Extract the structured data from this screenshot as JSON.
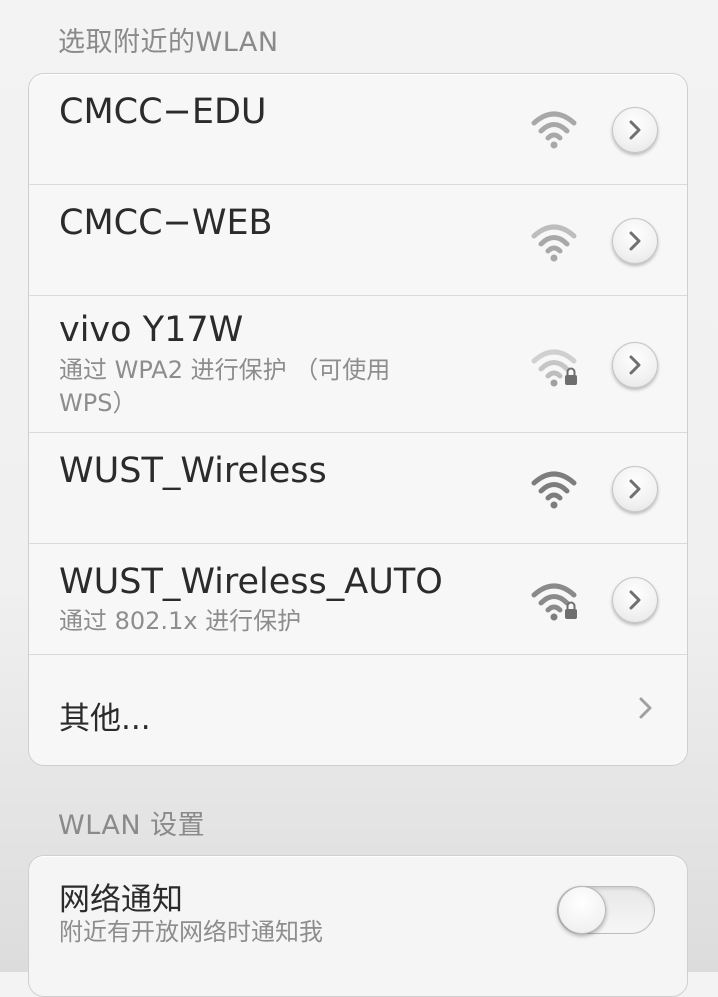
{
  "nearby_section": {
    "title": "选取附近的WLAN"
  },
  "networks": [
    {
      "ssid": "CMCC−EDU",
      "security": "",
      "signal_icon": "wifi-signal-icon",
      "locked": false
    },
    {
      "ssid": "CMCC−WEB",
      "security": "",
      "signal_icon": "wifi-signal-icon",
      "locked": false
    },
    {
      "ssid": "vivo Y17W",
      "security": "通过 WPA2 进行保护 （可使用 WPS）",
      "signal_icon": "wifi-lock-icon",
      "locked": true
    },
    {
      "ssid": "WUST_Wireless",
      "security": "",
      "signal_icon": "wifi-signal-icon",
      "locked": false
    },
    {
      "ssid": "WUST_Wireless_AUTO",
      "security": "通过 802.1x 进行保护",
      "signal_icon": "wifi-lock-icon",
      "locked": true
    }
  ],
  "other": {
    "label": "其他..."
  },
  "settings_section": {
    "title": "WLAN 设置"
  },
  "notify": {
    "title": "网络通知",
    "subtitle": "附近有开放网络时通知我",
    "enabled": false
  },
  "colors": {
    "wifi_strong": "#7d7d7d",
    "wifi_weak": "#a8a8a8",
    "wifi_faint": "#c2c2c2"
  }
}
